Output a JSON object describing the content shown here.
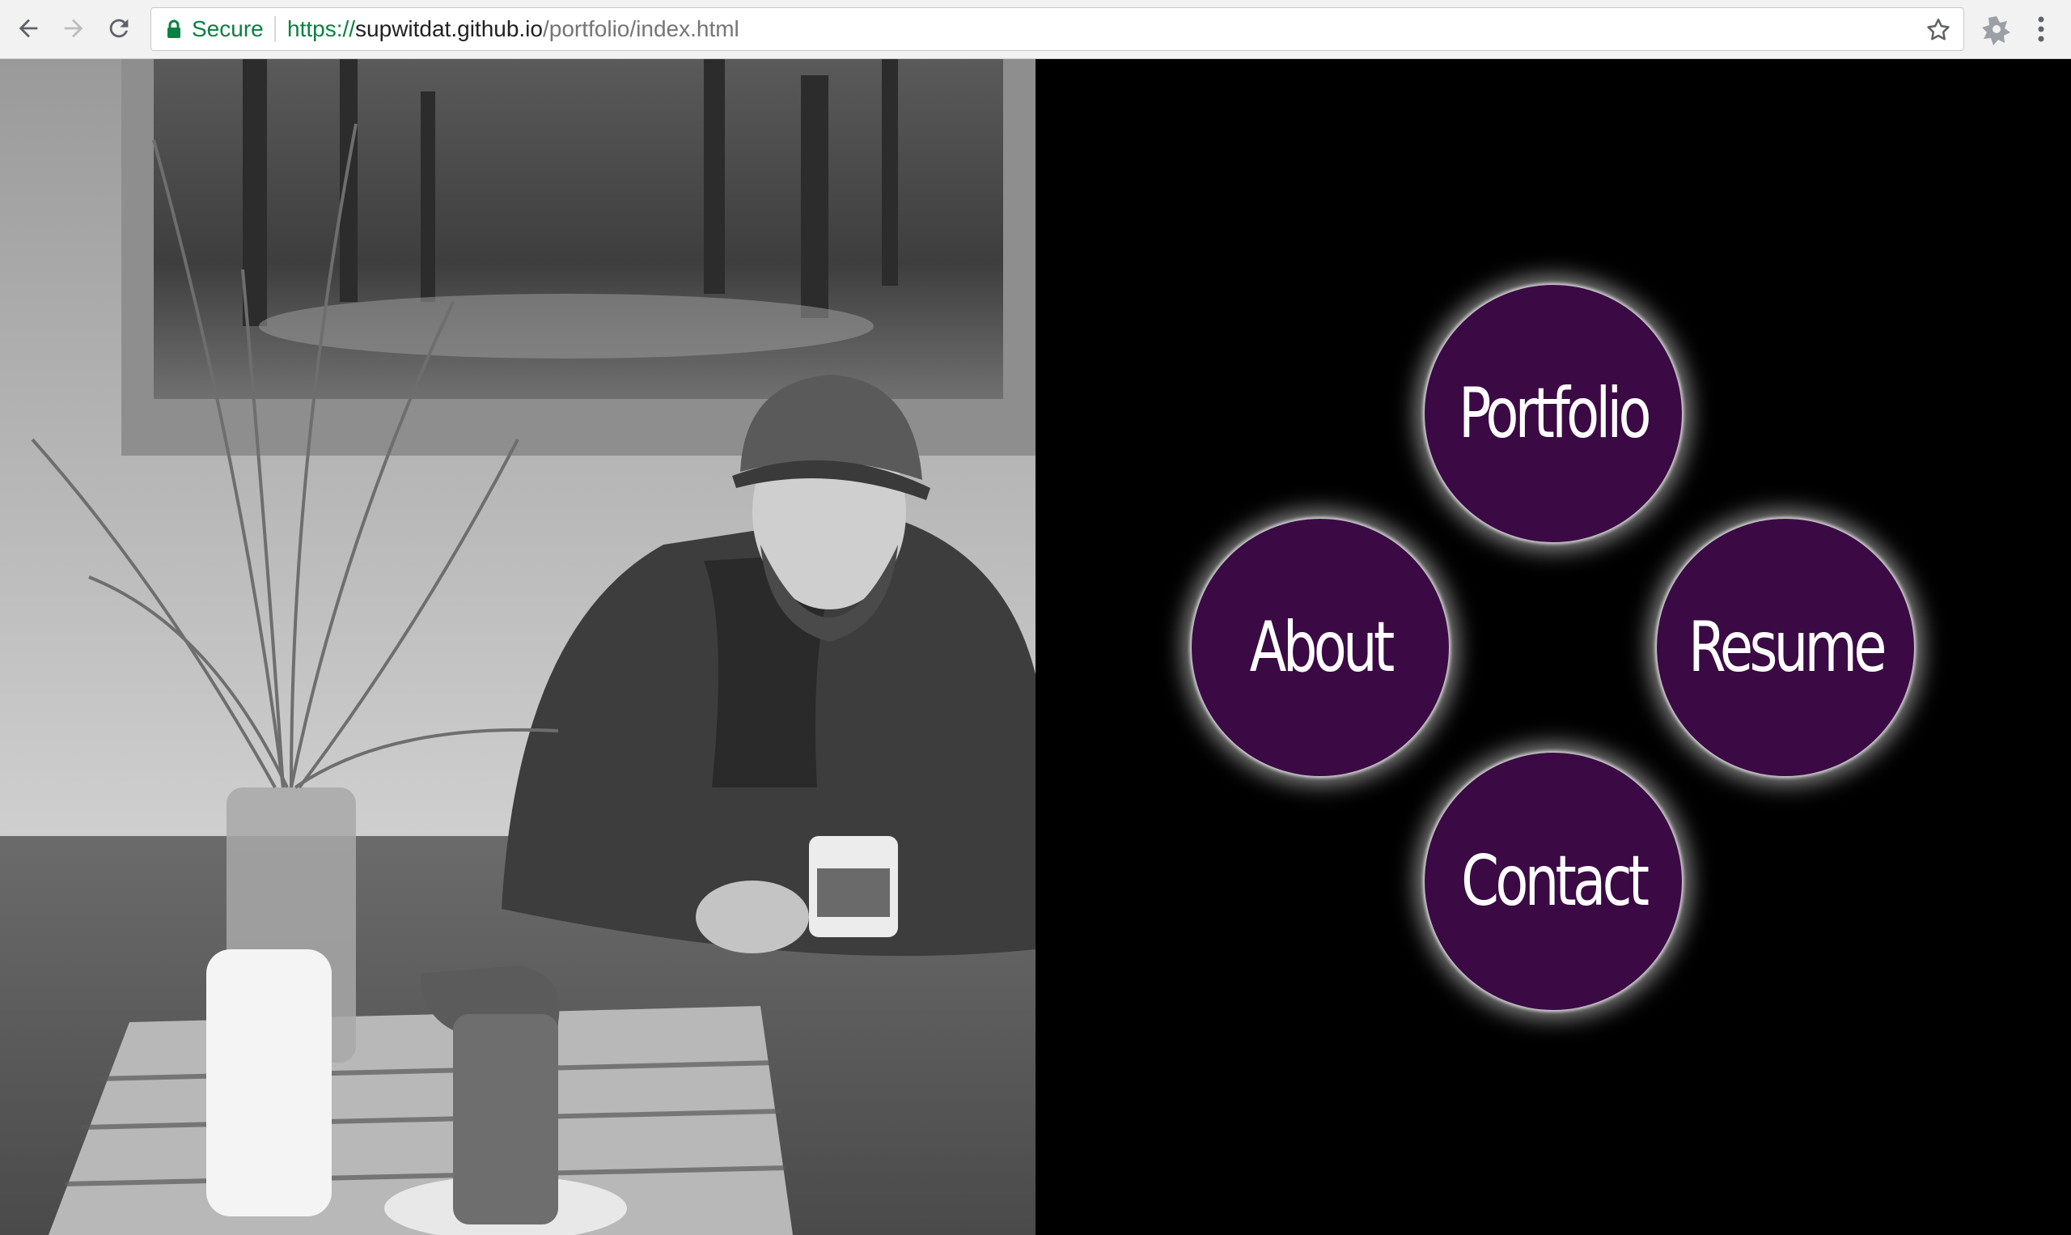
{
  "browser": {
    "secure_label": "Secure",
    "url_scheme": "https://",
    "url_host": "supwitdat.github.io",
    "url_path": "/portfolio/index.html",
    "icons": [
      "back-arrow-icon",
      "forward-arrow-icon",
      "reload-icon",
      "lock-icon",
      "bookmark-star-icon",
      "extension-icon",
      "menu-dots-icon"
    ],
    "secure_color": "#0b8043"
  },
  "hero": {
    "image_description": "grayscale photo"
  },
  "nav": {
    "items": [
      {
        "label": "Portfolio"
      },
      {
        "label": "About"
      },
      {
        "label": "Resume"
      },
      {
        "label": "Contact"
      }
    ],
    "circle_color": "#3b0a45",
    "glow_color": "#ffffff",
    "background": "#000000"
  }
}
